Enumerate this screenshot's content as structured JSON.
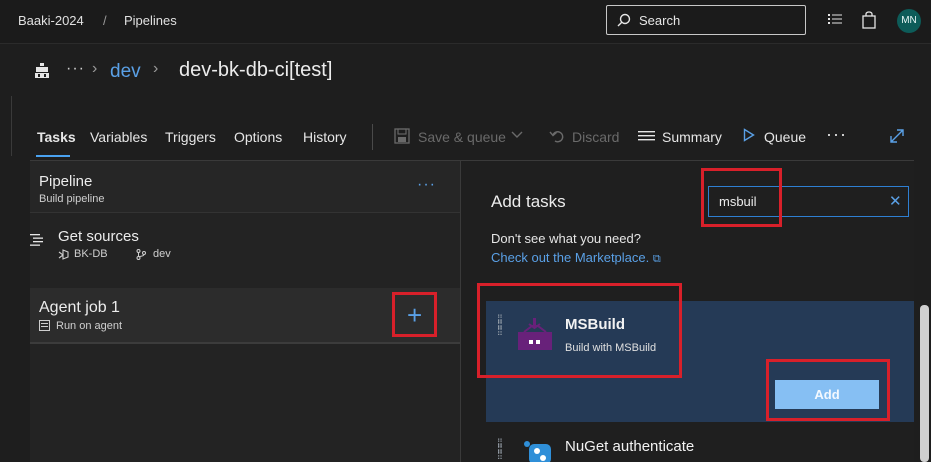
{
  "topbar": {
    "org": "Baaki-2024",
    "separator": "/",
    "section": "Pipelines",
    "search_placeholder": "Search",
    "avatar_initials": "MN"
  },
  "header": {
    "crumb_folder": "dev",
    "pipeline_title": "dev-bk-db-ci[test]"
  },
  "tabs": [
    {
      "label": "Tasks",
      "active": true
    },
    {
      "label": "Variables"
    },
    {
      "label": "Triggers"
    },
    {
      "label": "Options"
    },
    {
      "label": "History"
    }
  ],
  "commands": {
    "save_queue": "Save & queue",
    "discard": "Discard",
    "summary": "Summary",
    "queue": "Queue"
  },
  "pipeline": {
    "title": "Pipeline",
    "subtitle": "Build pipeline",
    "more": "···"
  },
  "get_sources": {
    "title": "Get sources",
    "repo": "BK-DB",
    "branch": "dev"
  },
  "agent_job": {
    "title": "Agent job 1",
    "subtitle": "Run on agent",
    "add_symbol": "+"
  },
  "add_tasks": {
    "heading": "Add tasks",
    "search_value": "msbuil",
    "help_text": "Don't see what you need?",
    "marketplace_link": "Check out the Marketplace.",
    "tasks": [
      {
        "name": "MSBuild",
        "description": "Build with MSBuild",
        "selected": true,
        "add_label": "Add"
      },
      {
        "name": "NuGet authenticate"
      }
    ]
  },
  "colors": {
    "highlight_red": "#d8202a",
    "accent_blue": "#5aa0e6",
    "selected_row": "#253a56",
    "add_button": "#86bff3"
  }
}
